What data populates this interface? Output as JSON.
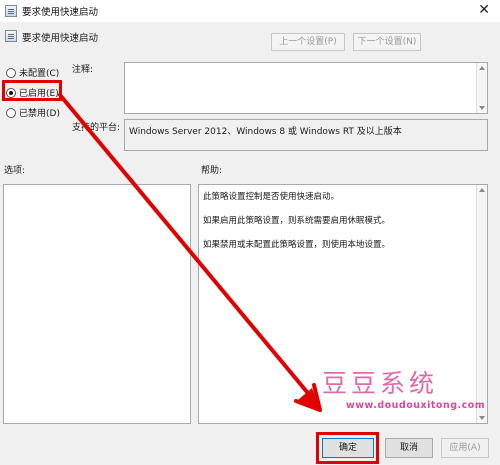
{
  "window": {
    "title": "要求使用快速启动",
    "close_glyph": "✕"
  },
  "policy": {
    "name": "要求使用快速启动",
    "prev_label": "上一个设置(P)",
    "next_label": "下一个设置(N)"
  },
  "state": {
    "options": [
      {
        "label": "未配置(C)",
        "checked": false
      },
      {
        "label": "已启用(E)",
        "checked": true
      },
      {
        "label": "已禁用(D)",
        "checked": false
      }
    ]
  },
  "comment": {
    "label": "注释:",
    "value": ""
  },
  "platform": {
    "label": "支持的平台:",
    "value": "Windows Server 2012、Windows 8 或 Windows RT 及以上版本"
  },
  "options_section": {
    "label": "选项:"
  },
  "help": {
    "label": "帮助:",
    "paragraphs": [
      "此策略设置控制是否使用快速启动。",
      "如果启用此策略设置，则系统需要启用休眠模式。",
      "如果禁用或未配置此策略设置，则使用本地设置。"
    ]
  },
  "buttons": {
    "ok": "确定",
    "cancel": "取消",
    "apply": "应用(A)"
  },
  "watermark": {
    "title": "豆豆系统",
    "url": "www.doudouxitong.com"
  },
  "annotation": {
    "color": "#e00000"
  }
}
